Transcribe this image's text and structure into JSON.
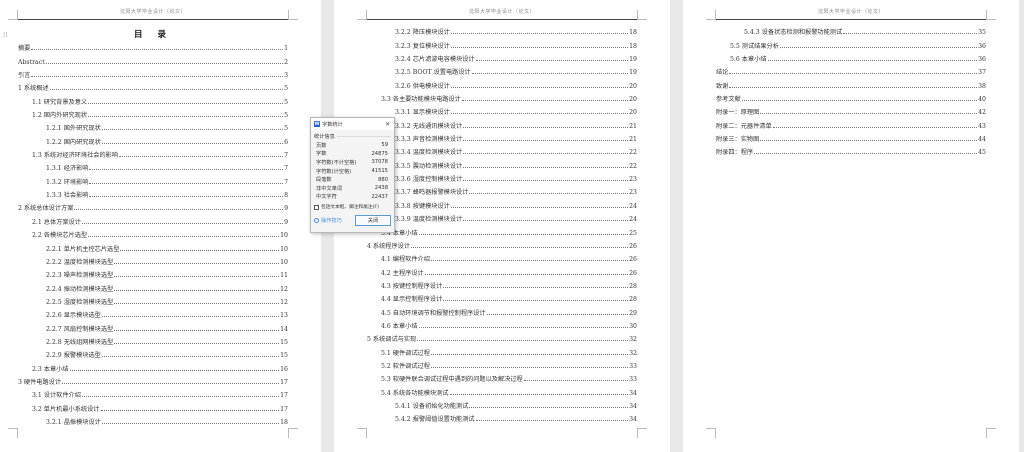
{
  "header_text": "沈阳大学毕业设计（论文）",
  "toc_title": "目 录",
  "pages": [
    {
      "rows": [
        [
          "摘要",
          "1",
          0
        ],
        [
          "Abstract",
          "2",
          0
        ],
        [
          "引言",
          "3",
          0
        ],
        [
          "1  系统概述",
          "5",
          0
        ],
        [
          "1.1  研究背景及意义",
          "5",
          1
        ],
        [
          "1.2  国内外研究现状",
          "5",
          1
        ],
        [
          "1.2.1  国外研究现状",
          "5",
          2
        ],
        [
          "1.2.2  国内研究现状",
          "6",
          2
        ],
        [
          "1.3 系统对经济环境社会的影响",
          "7",
          1
        ],
        [
          "1.3.1 经济影响",
          "7",
          2
        ],
        [
          "1.3.2 环境影响",
          "7",
          2
        ],
        [
          "1.3.3 社会影响",
          "8",
          2
        ],
        [
          "2  系统总体设计方案",
          "9",
          0
        ],
        [
          "2.1  总体方案设计",
          "9",
          1
        ],
        [
          "2.2  各模块芯片选型",
          "10",
          1
        ],
        [
          "2.2.1  单片机主控芯片选型",
          "10",
          2
        ],
        [
          "2.2.2  温度检测模块选型",
          "10",
          2
        ],
        [
          "2.2.3  噪声检测模块选型",
          "11",
          2
        ],
        [
          "2.2.4  振动检测模块选型",
          "12",
          2
        ],
        [
          "2.2.5  湿度检测模块选型",
          "12",
          2
        ],
        [
          "2.2.6  显示模块选型",
          "13",
          2
        ],
        [
          "2.2.7  风扇控制模块选型",
          "14",
          2
        ],
        [
          "2.2.8  无线组网模块选型",
          "15",
          2
        ],
        [
          "2.2.9  报警模块选型",
          "15",
          2
        ],
        [
          "2.3  本章小结",
          "16",
          1
        ],
        [
          "3  硬件电路设计",
          "17",
          0
        ],
        [
          "3.1  设计软件介绍",
          "17",
          1
        ],
        [
          "3.2  单片机最小系统设计",
          "17",
          1
        ],
        [
          "3.2.1  晶振模块设计",
          "18",
          2
        ]
      ]
    },
    {
      "rows": [
        [
          "3.2.2  降压模块设计",
          "18",
          2
        ],
        [
          "3.2.3  复位模块设计",
          "18",
          2
        ],
        [
          "3.2.4  芯片滤波电容模块设计",
          "19",
          2
        ],
        [
          "3.2.5 BOOT 设置电路设计",
          "19",
          2
        ],
        [
          "3.2.6  供电模块设计",
          "20",
          2
        ],
        [
          "3.3  各主要功能模块电路设计",
          "20",
          1
        ],
        [
          "3.3.1  显示模块设计",
          "20",
          2
        ],
        [
          "3.3.2  无线通讯模块设计",
          "21",
          2
        ],
        [
          "3.3.3  声音检测模块设计",
          "21",
          2
        ],
        [
          "3.3.4  温度检测模块设计",
          "22",
          2
        ],
        [
          "3.3.5  震动检测模块设计",
          "22",
          2
        ],
        [
          "3.3.6  湿度控制模块设计",
          "23",
          2
        ],
        [
          "3.3.7  蜂鸣器报警模块设计",
          "23",
          2
        ],
        [
          "3.3.8  按键模块设计",
          "24",
          2
        ],
        [
          "3.3.9  温度检测模块设计",
          "24",
          2
        ],
        [
          "3.4  本章小结",
          "25",
          1
        ],
        [
          "4  系统程序设计",
          "26",
          0
        ],
        [
          "4.1  编程软件介绍",
          "26",
          1
        ],
        [
          "4.2  主程序设计",
          "26",
          1
        ],
        [
          "4.3  按键控制程序设计",
          "28",
          1
        ],
        [
          "4.4  显示控制程序设计",
          "28",
          1
        ],
        [
          "4.5  自动环境调节和报警控制程序设计",
          "29",
          1
        ],
        [
          "4.6  本章小结",
          "30",
          1
        ],
        [
          "5  系统调试与实现",
          "32",
          0
        ],
        [
          "5.1  硬件调试过程",
          "32",
          1
        ],
        [
          "5.2  软件调试过程",
          "33",
          1
        ],
        [
          "5.3  软硬件联合调试过程中遇到的问题以及解决过程",
          "33",
          1
        ],
        [
          "5.4  系统各功能模块测试",
          "34",
          1
        ],
        [
          "5.4.1  设备初始化功能测试",
          "34",
          2
        ],
        [
          "5.4.2  报警阈值设置功能测试",
          "34",
          2
        ]
      ]
    },
    {
      "rows": [
        [
          "5.4.3  设备状态检测和报警功能测试",
          "35",
          2
        ],
        [
          "5.5  测试结果分析",
          "36",
          1
        ],
        [
          "5.6  本章小结",
          "36",
          1
        ],
        [
          "结论",
          "37",
          0
        ],
        [
          "致谢",
          "38",
          0
        ],
        [
          "参考文献",
          "40",
          0
        ],
        [
          "附录一：原理图",
          "42",
          0
        ],
        [
          "附录二：元器件清单",
          "43",
          0
        ],
        [
          "附录三：实物图",
          "44",
          0
        ],
        [
          "附录四：程序",
          "45",
          0
        ]
      ]
    }
  ],
  "dialog": {
    "title": "字数统计",
    "close_icon": "close-icon",
    "section": "统计信息",
    "stats": [
      [
        "页数",
        "59"
      ],
      [
        "字数",
        "24875"
      ],
      [
        "字符数(不计空格)",
        "37078"
      ],
      [
        "字符数(计空格)",
        "41515"
      ],
      [
        "段落数",
        "880"
      ],
      [
        "非中文单词",
        "2438"
      ],
      [
        "中文字符",
        "22437"
      ]
    ],
    "checkbox_label": "包括文本框、脚注和尾注(F)",
    "checkbox_checked": false,
    "tips_link": "操作技巧",
    "close_button": "关闭",
    "accent_color": "#2b63c6"
  }
}
